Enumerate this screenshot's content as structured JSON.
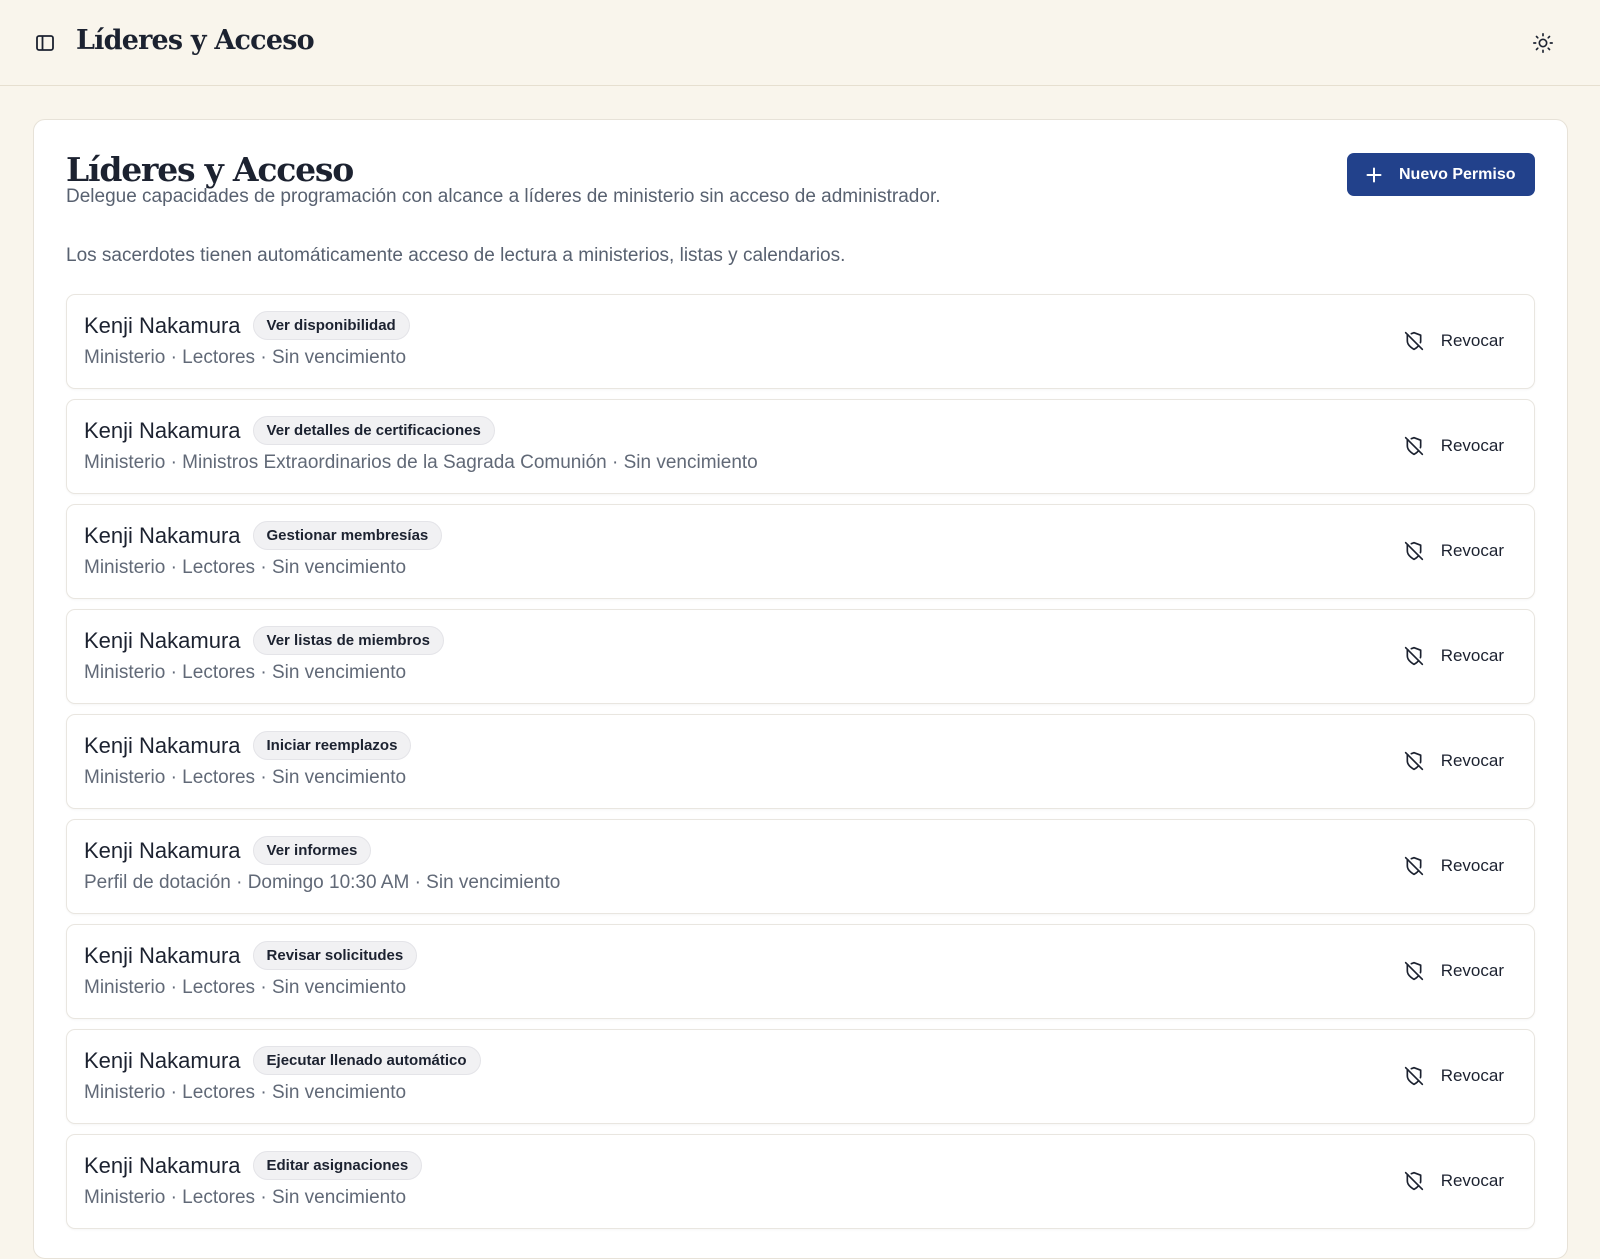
{
  "header": {
    "title": "Líderes y Acceso",
    "sidebar_toggle_icon": "sidebar-panel-icon",
    "theme_toggle_icon": "sun-icon"
  },
  "main": {
    "title": "Líderes y Acceso",
    "subtitle": "Delegue capacidades de programación con alcance a líderes de ministerio sin acceso de administrador.",
    "notice": "Los sacerdotes tienen automáticamente acceso de lectura a ministerios, listas y calendarios.",
    "new_button_label": "Nuevo Permiso",
    "accent_color": "#22418b"
  },
  "permissions": [
    {
      "name": "Kenji Nakamura",
      "capability": "Ver disponibilidad",
      "meta": "Ministerio · Lectores · Sin vencimiento",
      "action": "Revocar"
    },
    {
      "name": "Kenji Nakamura",
      "capability": "Ver detalles de certificaciones",
      "meta": "Ministerio · Ministros Extraordinarios de la Sagrada Comunión · Sin vencimiento",
      "action": "Revocar"
    },
    {
      "name": "Kenji Nakamura",
      "capability": "Gestionar membresías",
      "meta": "Ministerio · Lectores · Sin vencimiento",
      "action": "Revocar"
    },
    {
      "name": "Kenji Nakamura",
      "capability": "Ver listas de miembros",
      "meta": "Ministerio · Lectores · Sin vencimiento",
      "action": "Revocar"
    },
    {
      "name": "Kenji Nakamura",
      "capability": "Iniciar reemplazos",
      "meta": "Ministerio · Lectores · Sin vencimiento",
      "action": "Revocar"
    },
    {
      "name": "Kenji Nakamura",
      "capability": "Ver informes",
      "meta": "Perfil de dotación · Domingo 10:30 AM · Sin vencimiento",
      "action": "Revocar"
    },
    {
      "name": "Kenji Nakamura",
      "capability": "Revisar solicitudes",
      "meta": "Ministerio · Lectores · Sin vencimiento",
      "action": "Revocar"
    },
    {
      "name": "Kenji Nakamura",
      "capability": "Ejecutar llenado automático",
      "meta": "Ministerio · Lectores · Sin vencimiento",
      "action": "Revocar"
    },
    {
      "name": "Kenji Nakamura",
      "capability": "Editar asignaciones",
      "meta": "Ministerio · Lectores · Sin vencimiento",
      "action": "Revocar"
    }
  ]
}
